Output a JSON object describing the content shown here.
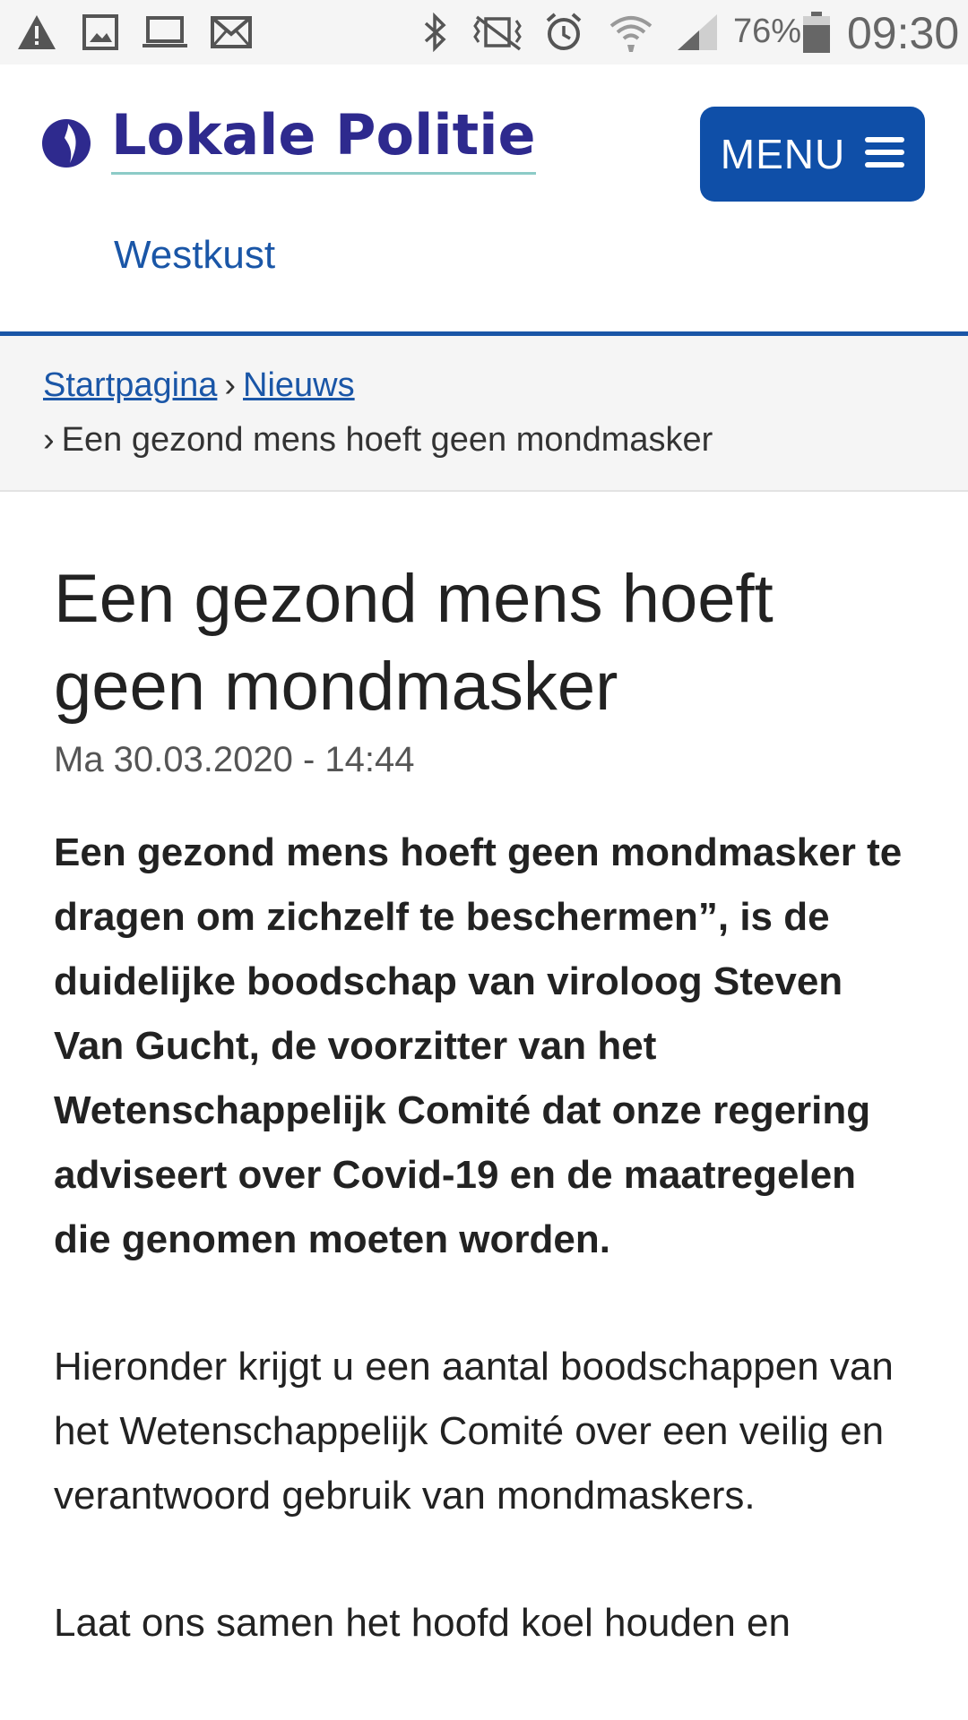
{
  "status_bar": {
    "left_icons": [
      "warning-icon",
      "image-icon",
      "laptop-icon",
      "mail-icon"
    ],
    "right_icons": [
      "bluetooth-icon",
      "vibrate-icon",
      "alarm-icon",
      "wifi-icon",
      "signal-icon",
      "battery-icon"
    ],
    "battery_percent": "76%",
    "time": "09:30"
  },
  "header": {
    "logo_title": "Lokale Politie",
    "logo_subtitle": "Westkust",
    "menu_label": "MENU",
    "brand_color": "#2e2a8e",
    "accent_color": "#0f4fa8"
  },
  "breadcrumb": {
    "items": [
      {
        "label": "Startpagina"
      },
      {
        "label": "Nieuws"
      }
    ],
    "current": "Een gezond mens hoeft geen mondmasker"
  },
  "article": {
    "title": "Een gezond mens hoeft geen mondmasker",
    "date": "Ma 30.03.2020 - 14:44",
    "lead": "Een gezond mens hoeft geen mondmasker te dragen om zichzelf te beschermen”, is de duidelijke boodschap van viroloog Steven Van Gucht, de voorzitter van het Wetenschappelijk Comité dat onze regering adviseert over Covid-19 en de maatregelen die genomen moeten worden.",
    "paragraphs": [
      "Hieronder krijgt u een aantal boodschappen van het Wetenschappelijk Comité over een veilig en verantwoord gebruik van mondmaskers.",
      "Laat ons samen het hoofd koel houden en"
    ]
  }
}
